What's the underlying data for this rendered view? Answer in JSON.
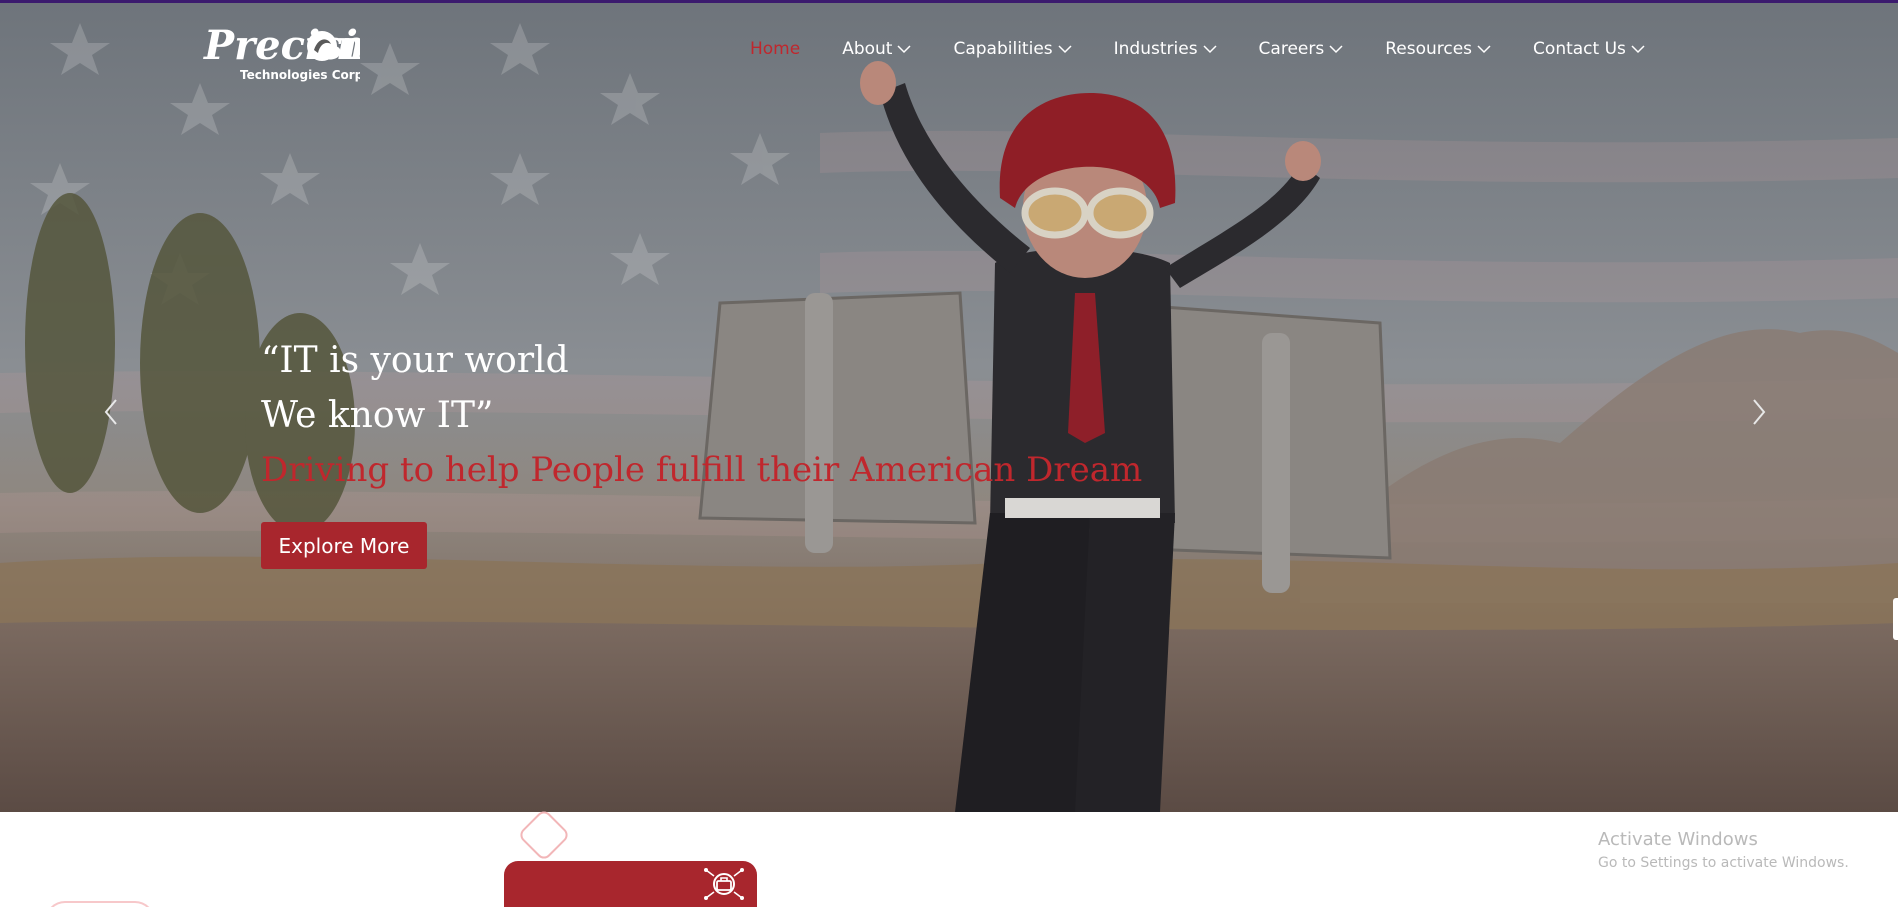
{
  "colors": {
    "accent": "#c0272d",
    "button": "#a8262d",
    "nav_text": "#ffffff",
    "top_strip": "#3b1a6e",
    "watermark": "#b9b9b9"
  },
  "logo": {
    "name": "Precision",
    "subtitle": "Technologies Corp."
  },
  "nav": {
    "items": [
      {
        "label": "Home",
        "active": true,
        "has_dropdown": false
      },
      {
        "label": "About",
        "has_dropdown": true
      },
      {
        "label": "Capabilities",
        "has_dropdown": true
      },
      {
        "label": "Industries",
        "has_dropdown": true
      },
      {
        "label": "Careers",
        "has_dropdown": true
      },
      {
        "label": "Resources",
        "has_dropdown": true
      },
      {
        "label": "Contact Us",
        "has_dropdown": true
      }
    ]
  },
  "hero": {
    "line1": "“IT is your world",
    "line2": "We know IT”",
    "tagline": "Driving to help People fulfill their American Dream",
    "cta_label": "Explore More",
    "prev_icon": "chevron-left-icon",
    "next_icon": "chevron-right-icon"
  },
  "watermark": {
    "title": "Activate Windows",
    "subtitle": "Go to Settings to activate Windows."
  }
}
